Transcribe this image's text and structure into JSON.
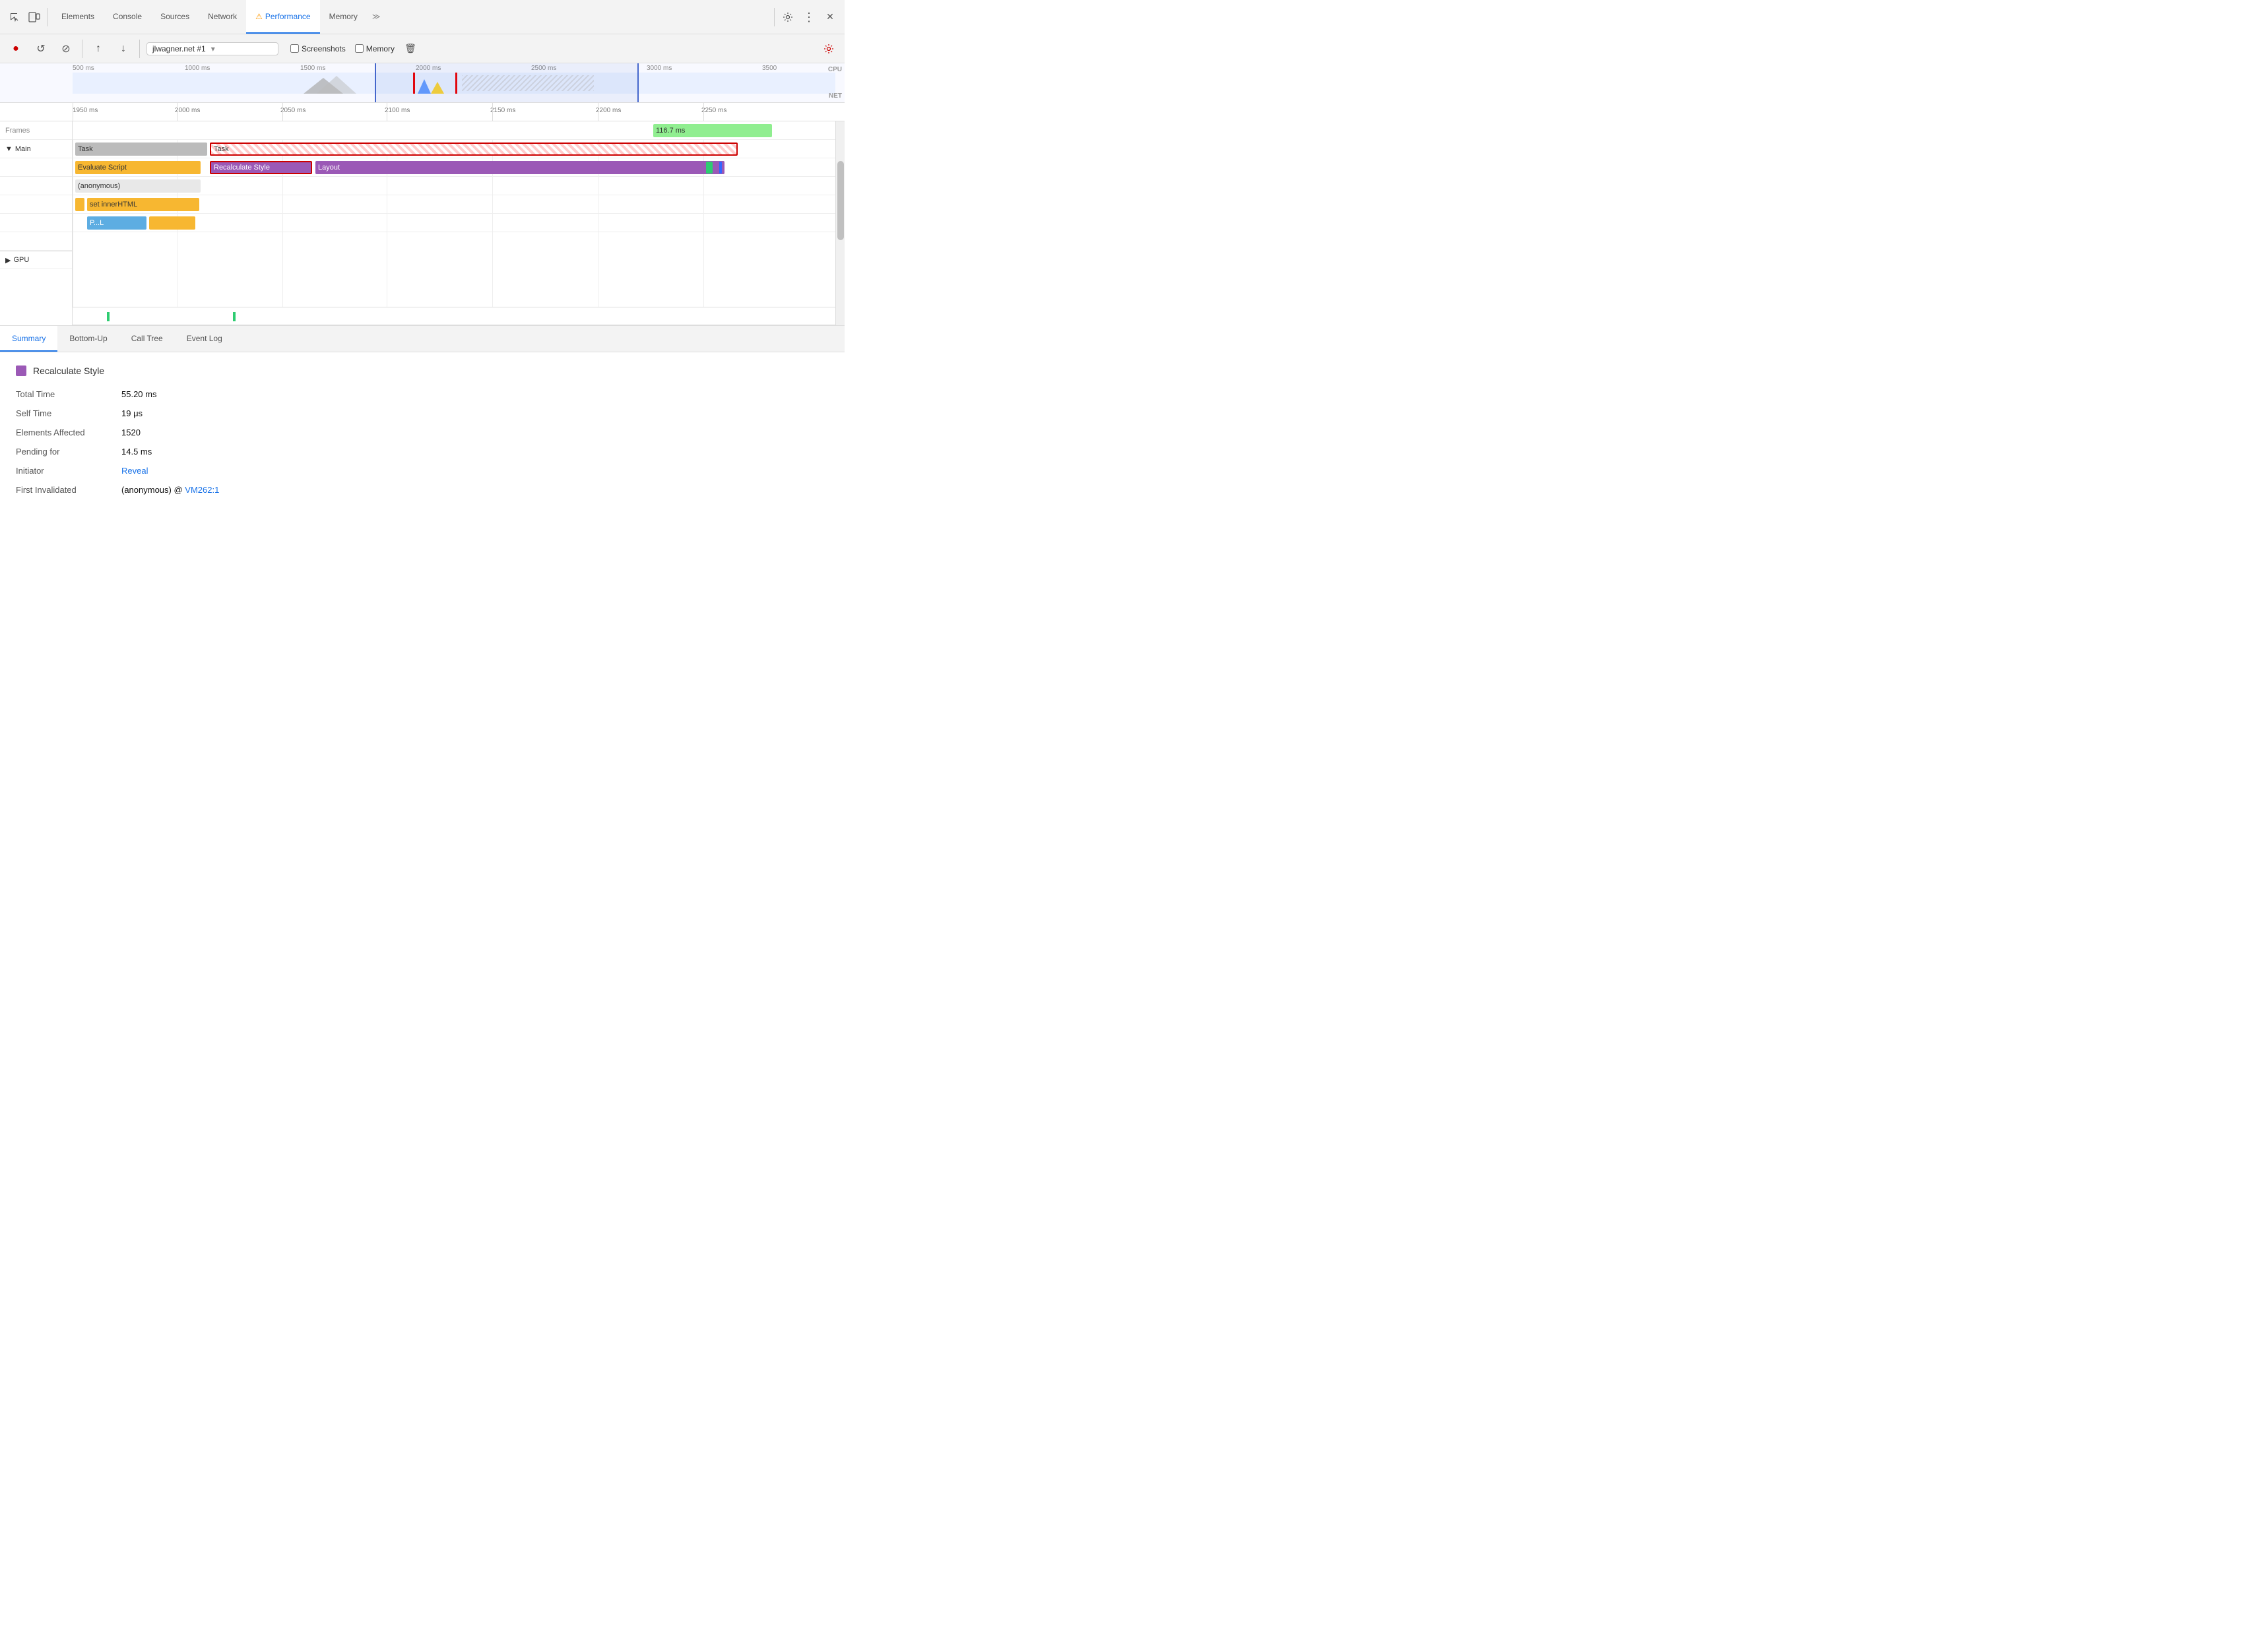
{
  "tabs": {
    "items": [
      {
        "label": "Elements",
        "active": false
      },
      {
        "label": "Console",
        "active": false
      },
      {
        "label": "Sources",
        "active": false
      },
      {
        "label": "Network",
        "active": false
      },
      {
        "label": "Performance",
        "active": true,
        "warning": true
      },
      {
        "label": "Memory",
        "active": false
      }
    ],
    "more_icon": "≫",
    "settings_icon": "⚙",
    "menu_icon": "⋮",
    "close_icon": "✕"
  },
  "toolbar": {
    "record_label": "●",
    "reload_label": "↺",
    "clear_label": "⊘",
    "upload_label": "↑",
    "download_label": "↓",
    "url_value": "jlwagner.net #1",
    "screenshots_label": "Screenshots",
    "memory_label": "Memory",
    "trash_icon": "🗑"
  },
  "overview": {
    "ticks": [
      "500 ms",
      "1000 ms",
      "1500 ms",
      "2000 ms",
      "2500 ms",
      "3000 ms",
      "3500"
    ],
    "cpu_label": "CPU",
    "net_label": "NET"
  },
  "zoom_ticks": [
    "1950 ms",
    "2000 ms",
    "2050 ms",
    "2100 ms",
    "2150 ms",
    "2200 ms",
    "2250 ms"
  ],
  "flame": {
    "left_rows": [
      {
        "label": "Frames",
        "triangle": ""
      },
      {
        "label": "▼ Main",
        "triangle": "▼"
      },
      {
        "label": "▶ GPU",
        "triangle": "▶"
      }
    ],
    "frames_label": "116.7 ms",
    "blocks": [
      {
        "id": "task1",
        "label": "Task",
        "class": "task-gray"
      },
      {
        "id": "task2",
        "label": "Task",
        "class": "task-gray-hatched"
      },
      {
        "id": "evaluate",
        "label": "Evaluate Script",
        "class": "evaluate-script"
      },
      {
        "id": "recalc",
        "label": "Recalculate Style",
        "class": "recalc-style"
      },
      {
        "id": "layout",
        "label": "Layout",
        "class": "layout"
      },
      {
        "id": "anon",
        "label": "(anonymous)",
        "class": "anonymous"
      },
      {
        "id": "sethtml",
        "label": "set innerHTML",
        "class": "set-inner-html"
      },
      {
        "id": "pll",
        "label": "P...L",
        "class": "pll"
      },
      {
        "id": "pll2",
        "label": "",
        "class": "pll-yellow"
      }
    ]
  },
  "bottom_tabs": [
    {
      "label": "Summary",
      "active": true
    },
    {
      "label": "Bottom-Up",
      "active": false
    },
    {
      "label": "Call Tree",
      "active": false
    },
    {
      "label": "Event Log",
      "active": false
    }
  ],
  "summary": {
    "title": "Recalculate Style",
    "color": "#9b59b6",
    "rows": [
      {
        "label": "Total Time",
        "value": "55.20 ms"
      },
      {
        "label": "Self Time",
        "value": "19 μs"
      },
      {
        "label": "Elements Affected",
        "value": "1520"
      },
      {
        "label": "Pending for",
        "value": "14.5 ms"
      },
      {
        "label": "Initiator",
        "value_link": "Reveal",
        "value_link_href": "#"
      },
      {
        "label": "First Invalidated",
        "value_prefix": "(anonymous) @ ",
        "value_link": "VM262:1",
        "value_link_href": "#"
      }
    ]
  }
}
